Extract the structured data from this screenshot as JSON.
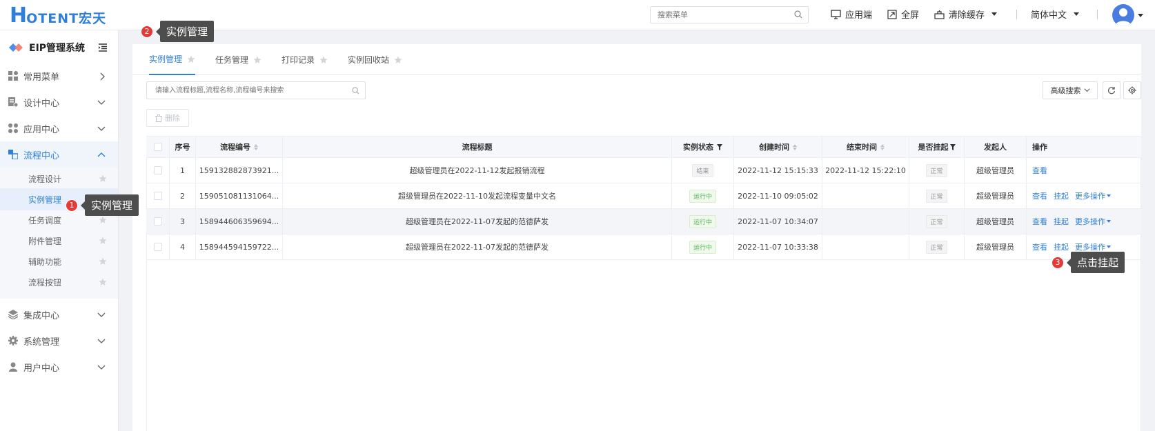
{
  "header": {
    "logo_main": "H",
    "logo_rest": "OTENT宏天",
    "search_placeholder": "搜索菜单",
    "actions": {
      "app_client": "应用端",
      "fullscreen": "全屏",
      "clear_cache": "清除缓存",
      "language": "简体中文"
    }
  },
  "sidebar": {
    "system_title": "EIP管理系统",
    "menu": {
      "common": "常用菜单",
      "design": "设计中心",
      "app": "应用中心",
      "process": "流程中心",
      "integration": "集成中心",
      "system": "系统管理",
      "user": "用户中心"
    },
    "submenu": [
      "流程设计",
      "实例管理",
      "任务调度",
      "附件管理",
      "辅助功能",
      "流程按钮"
    ]
  },
  "callouts": [
    {
      "number": "1",
      "text": "实例管理"
    },
    {
      "number": "2",
      "text": "实例管理"
    },
    {
      "number": "3",
      "text": "点击挂起"
    }
  ],
  "tabs": [
    "实例管理",
    "任务管理",
    "打印记录",
    "实例回收站"
  ],
  "toolbar": {
    "filter_placeholder": "请输入流程标题,流程名称,流程编号来搜索",
    "advanced_search": "高级搜索",
    "delete": "删除"
  },
  "table": {
    "headers": {
      "index": "序号",
      "code": "流程编号",
      "title": "流程标题",
      "status": "实例状态",
      "created": "创建时间",
      "ended": "结束时间",
      "suspended": "是否挂起",
      "initiator": "发起人",
      "actions": "操作"
    },
    "rows": [
      {
        "index": "1",
        "code": "159132882873921...",
        "title": "超级管理员在2022-11-12发起报销流程",
        "status": "结束",
        "created": "2022-11-12 15:15:33",
        "ended": "2022-11-12 15:22:10",
        "suspended": "正常",
        "initiator": "超级管理员"
      },
      {
        "index": "2",
        "code": "159051081131064...",
        "title": "超级管理员在2022-11-10发起流程变量中文名",
        "status": "运行中",
        "created": "2022-11-10 09:05:02",
        "ended": "",
        "suspended": "正常",
        "initiator": "超级管理员"
      },
      {
        "index": "3",
        "code": "158944606359694...",
        "title": "超级管理员在2022-11-07发起的范德萨发",
        "status": "运行中",
        "created": "2022-11-07 10:34:07",
        "ended": "",
        "suspended": "正常",
        "initiator": "超级管理员"
      },
      {
        "index": "4",
        "code": "158944594159722...",
        "title": "超级管理员在2022-11-07发起的范德萨发",
        "status": "运行中",
        "created": "2022-11-07 10:33:38",
        "ended": "",
        "suspended": "正常",
        "initiator": "超级管理员"
      }
    ],
    "ops": {
      "view": "查看",
      "suspend": "挂起",
      "more": "更多操作"
    }
  },
  "colors": {
    "accent": "#2f7fd9",
    "badge": "#e53935",
    "callout_bg": "#4d4d4d",
    "running": "#52b35a"
  }
}
